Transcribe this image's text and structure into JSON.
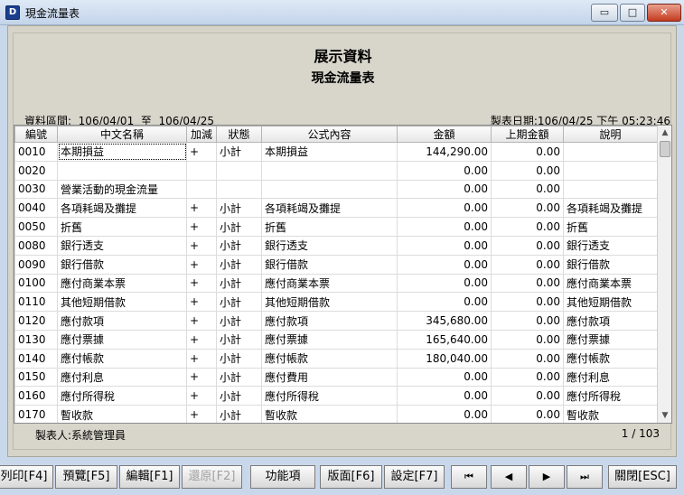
{
  "window": {
    "title": "現金流量表",
    "app_icon": "D",
    "controls": {
      "minimize": "▭",
      "maximize": "□",
      "close": "✕"
    }
  },
  "report": {
    "title": "展示資料",
    "subtitle": "現金流量表",
    "period": "資料區間:  106/04/01  至  106/04/25",
    "print_date": "製表日期:106/04/25 下午 05:23:46",
    "columns": [
      "編號",
      "中文名稱",
      "加減",
      "狀態",
      "公式內容",
      "金額",
      "上期金額",
      "說明"
    ],
    "rows": [
      [
        "0010",
        "本期損益",
        "+",
        "小計",
        "本期損益",
        "144,290.00",
        "0.00",
        ""
      ],
      [
        "0020",
        "",
        "",
        "",
        "",
        "0.00",
        "0.00",
        ""
      ],
      [
        "0030",
        "營業活動的現金流量",
        "",
        "",
        "",
        "0.00",
        "0.00",
        ""
      ],
      [
        "0040",
        "各項耗竭及攤提",
        "+",
        "小計",
        "各項耗竭及攤提",
        "0.00",
        "0.00",
        "各項耗竭及攤提"
      ],
      [
        "0050",
        "折舊",
        "+",
        "小計",
        "折舊",
        "0.00",
        "0.00",
        "折舊"
      ],
      [
        "0080",
        "銀行透支",
        "+",
        "小計",
        "銀行透支",
        "0.00",
        "0.00",
        "銀行透支"
      ],
      [
        "0090",
        "銀行借款",
        "+",
        "小計",
        "銀行借款",
        "0.00",
        "0.00",
        "銀行借款"
      ],
      [
        "0100",
        "應付商業本票",
        "+",
        "小計",
        "應付商業本票",
        "0.00",
        "0.00",
        "應付商業本票"
      ],
      [
        "0110",
        "其他短期借款",
        "+",
        "小計",
        "其他短期借款",
        "0.00",
        "0.00",
        "其他短期借款"
      ],
      [
        "0120",
        "應付款項",
        "+",
        "小計",
        "應付款項",
        "345,680.00",
        "0.00",
        "應付款項"
      ],
      [
        "0130",
        "應付票據",
        "+",
        "小計",
        "應付票據",
        "165,640.00",
        "0.00",
        "應付票據"
      ],
      [
        "0140",
        "應付帳款",
        "+",
        "小計",
        "應付帳款",
        "180,040.00",
        "0.00",
        "應付帳款"
      ],
      [
        "0150",
        "應付利息",
        "+",
        "小計",
        "應付費用",
        "0.00",
        "0.00",
        "應付利息"
      ],
      [
        "0160",
        "應付所得稅",
        "+",
        "小計",
        "應付所得稅",
        "0.00",
        "0.00",
        "應付所得稅"
      ],
      [
        "0170",
        "暫收款",
        "+",
        "小計",
        "暫收款",
        "0.00",
        "0.00",
        "暫收款"
      ]
    ],
    "preparer": "製表人:系統管理員",
    "page_info": "1 / 103"
  },
  "toolbar": {
    "print": "列印[F4]",
    "preview": "預覽[F5]",
    "edit": "編輯[F1]",
    "restore": "還原[F2]",
    "functions": "功能項",
    "layout": "版面[F6]",
    "settings": "設定[F7]",
    "first": "⏮",
    "prev": "◀",
    "next": "▶",
    "last": "⏭",
    "close": "關閉[ESC]"
  }
}
